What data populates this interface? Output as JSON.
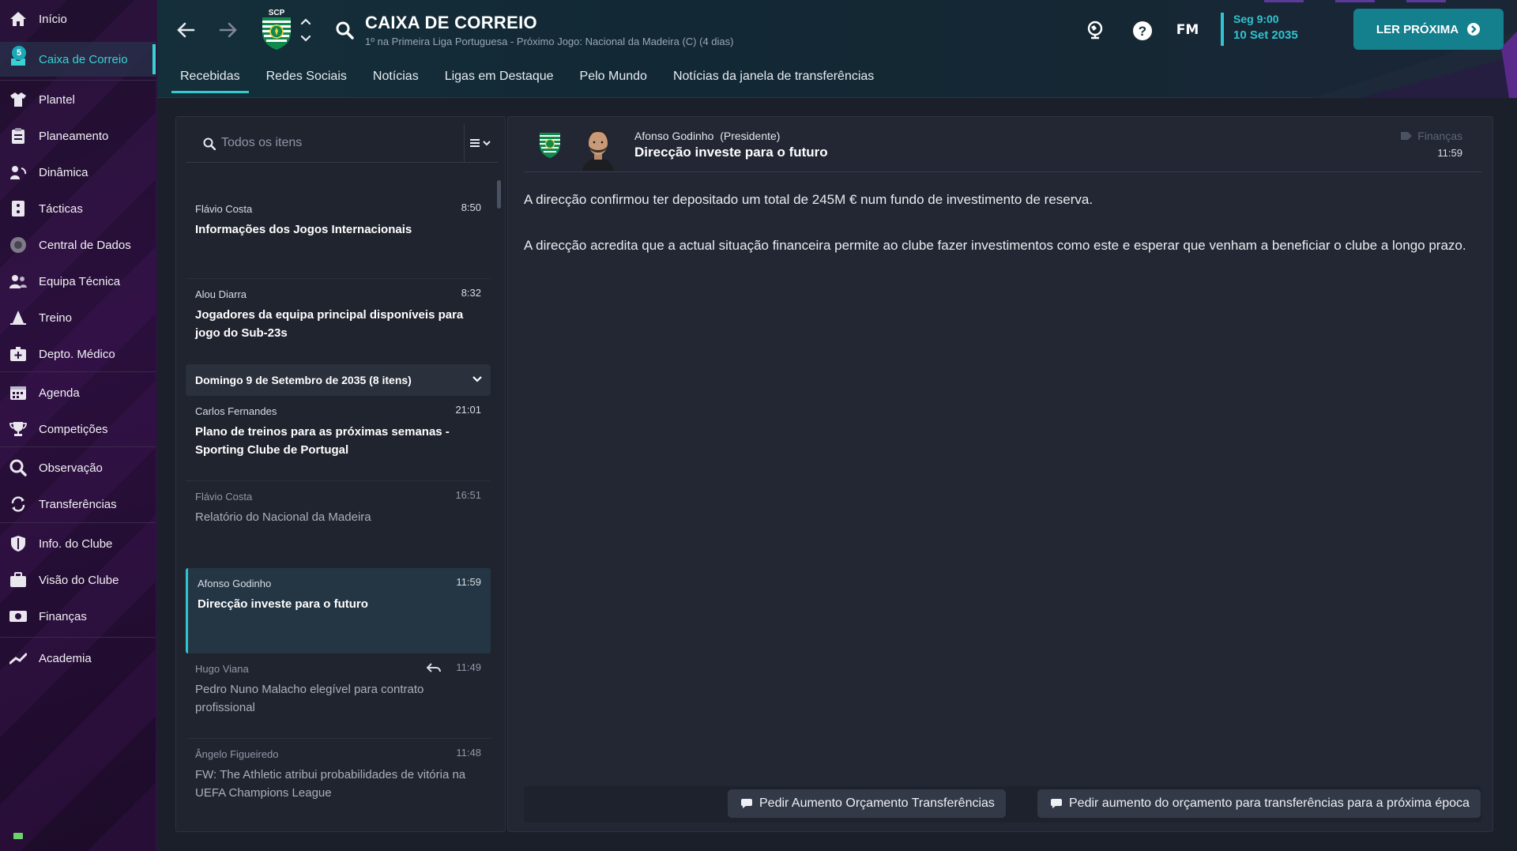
{
  "sidebar": {
    "items": [
      {
        "label": "Início",
        "icon": "home-icon"
      },
      {
        "label": "Caixa de Correio",
        "icon": "inbox-icon",
        "badge": "5",
        "active": true
      },
      {
        "label": "Plantel",
        "icon": "shirt-icon"
      },
      {
        "label": "Planeamento",
        "icon": "clipboard-icon"
      },
      {
        "label": "Dinâmica",
        "icon": "dynamics-icon"
      },
      {
        "label": "Tácticas",
        "icon": "tactics-board-icon"
      },
      {
        "label": "Central de Dados",
        "icon": "data-hub-icon"
      },
      {
        "label": "Equipa Técnica",
        "icon": "staff-icon"
      },
      {
        "label": "Treino",
        "icon": "training-cone-icon"
      },
      {
        "label": "Depto. Médico",
        "icon": "medical-kit-icon"
      },
      {
        "label": "Agenda",
        "icon": "calendar-icon"
      },
      {
        "label": "Competições",
        "icon": "trophy-icon"
      },
      {
        "label": "Observação",
        "icon": "magnifier-icon"
      },
      {
        "label": "Transferências",
        "icon": "transfer-arrows-icon"
      },
      {
        "label": "Info. do Clube",
        "icon": "club-shield-icon"
      },
      {
        "label": "Visão do Clube",
        "icon": "briefcase-icon"
      },
      {
        "label": "Finanças",
        "icon": "money-icon"
      },
      {
        "label": "Academia",
        "icon": "academy-trend-icon"
      }
    ]
  },
  "header": {
    "club_badge": "SCP",
    "title": "CAIXA DE CORREIO",
    "subtitle": "1º na Primeira Liga Portuguesa - Próximo Jogo: Nacional da Madeira (C) (4 dias)",
    "fm_label": "FM",
    "date_line1": "Seg 9:00",
    "date_line2": "10 Set 2035",
    "read_next": "LER PRÓXIMA",
    "tabs": [
      "Recebidas",
      "Redes Sociais",
      "Notícias",
      "Ligas em Destaque",
      "Pelo Mundo",
      "Notícias da janela de transferências"
    ]
  },
  "inbox": {
    "search_placeholder": "Todos os itens",
    "group_label": "Domingo 9 de Setembro de 2035 (8 itens)",
    "messages": [
      {
        "from": "Flávio Costa",
        "time": "8:50",
        "subject": "Informações dos Jogos Internacionais"
      },
      {
        "from": "Alou Diarra",
        "time": "8:32",
        "subject": "Jogadores da equipa principal disponíveis para jogo do Sub-23s"
      },
      {
        "from": "Carlos Fernandes",
        "time": "21:01",
        "subject": "Plano de treinos para as próximas semanas - Sporting Clube de Portugal"
      },
      {
        "from": "Flávio Costa",
        "time": "16:51",
        "subject": "Relatório do Nacional da Madeira"
      },
      {
        "from": "Afonso Godinho",
        "time": "11:59",
        "subject": "Direcção investe para o futuro"
      },
      {
        "from": "Hugo Viana",
        "time": "11:49",
        "subject": "Pedro Nuno Malacho elegível para contrato profissional"
      },
      {
        "from": "Ângelo Figueiredo",
        "time": "11:48",
        "subject": "FW: The Athletic atribui probabilidades de vitória na UEFA Champions League"
      }
    ]
  },
  "detail": {
    "sender": "Afonso Godinho",
    "role": "(Presidente)",
    "title": "Direcção investe para o futuro",
    "category": "Finanças",
    "time": "11:59",
    "paragraphs": [
      "A direcção confirmou ter depositado um total de 245M € num fundo de investimento de reserva.",
      "A direcção acredita que a actual situação financeira permite ao clube fazer investimentos como este e esperar que venham a beneficiar o clube a longo prazo."
    ],
    "actions": [
      "Pedir Aumento Orçamento Transferências",
      "Pedir aumento do orçamento para transferências para a próxima época"
    ]
  },
  "colors": {
    "accent": "#2fc4d0",
    "sidebar": "#2a0f3c",
    "header": "#152f3a",
    "panel": "#222733",
    "button": "#147f8d"
  }
}
